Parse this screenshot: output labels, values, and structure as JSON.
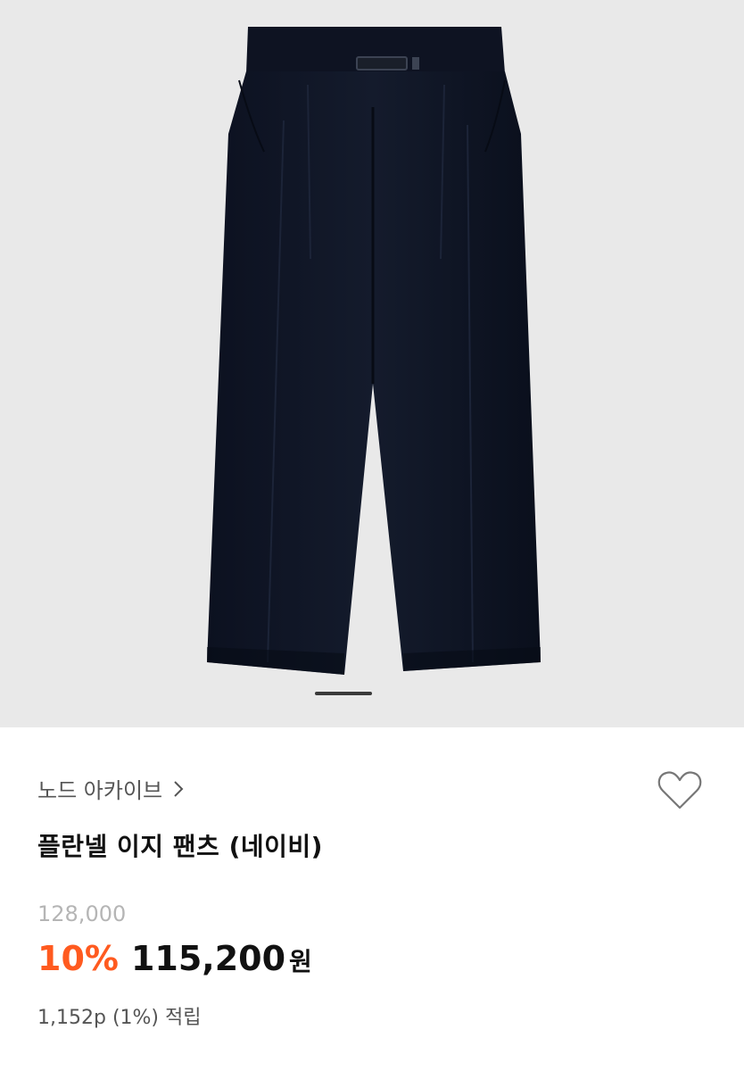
{
  "gallery": {
    "image_icon": "navy-pleated-trousers-image",
    "slide_count": 1,
    "current_slide": 1,
    "colors": {
      "background": "#e9e9e9",
      "product": "#0f1524"
    }
  },
  "product": {
    "brand": "노드 아카이브",
    "brand_chevron_icon": "chevron-right-icon",
    "wish_icon": "heart-outline-icon",
    "name": "플란넬 이지 팬츠 (네이비)",
    "original_price": "128,000",
    "discount_rate": "10%",
    "sale_price": "115,200",
    "currency": "원",
    "points": "1,152p (1%) 적립"
  },
  "colors": {
    "discount": "#ff5a1f",
    "original_price": "#b5b5b5",
    "text_primary": "#111111",
    "text_secondary": "#555555"
  }
}
